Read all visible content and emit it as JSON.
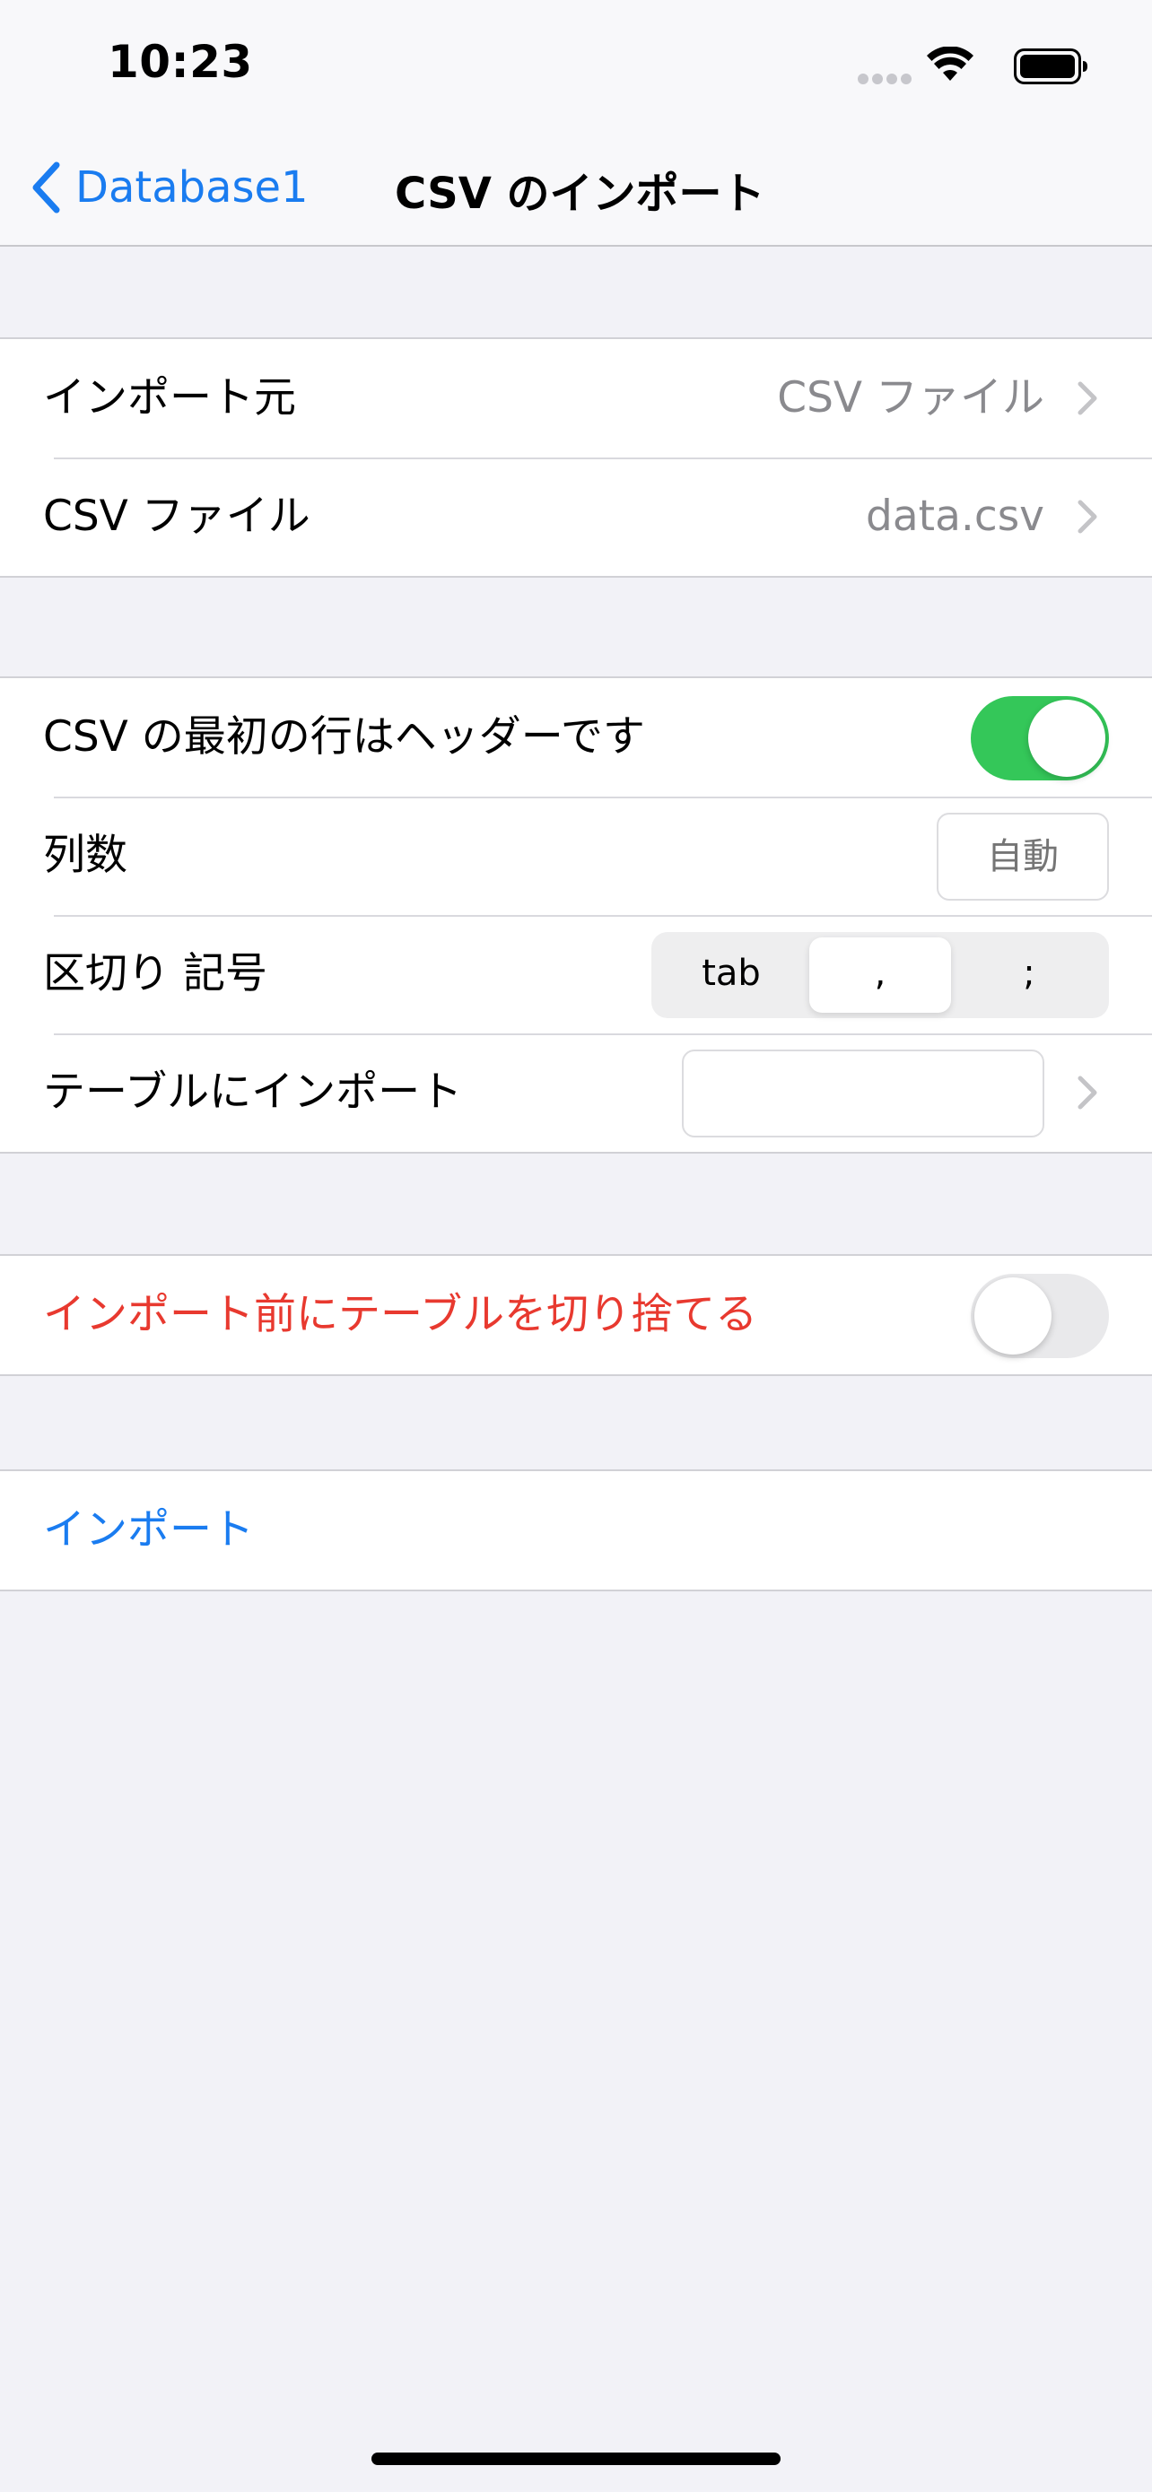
{
  "status_bar": {
    "time": "10:23"
  },
  "nav": {
    "back_label": "Database1",
    "title": "CSV のインポート"
  },
  "source_section": {
    "import_from_label": "インポート元",
    "import_from_value": "CSV ファイル",
    "csv_file_label": "CSV ファイル",
    "csv_file_value": "data.csv"
  },
  "options_section": {
    "header_row_label": "CSV の最初の行はヘッダーです",
    "header_row_enabled": true,
    "column_count_label": "列数",
    "column_count_placeholder": "自動",
    "delimiter_label": "区切り 記号",
    "delimiter_options": [
      "tab",
      ",",
      ";"
    ],
    "delimiter_selected": ",",
    "import_to_table_label": "テーブルにインポート",
    "import_to_table_value": ""
  },
  "truncate_section": {
    "label": "インポート前にテーブルを切り捨てる",
    "enabled": false
  },
  "action_section": {
    "import_label": "インポート"
  },
  "colors": {
    "accent": "#1a7cf0",
    "toggle_on": "#34c759",
    "danger": "#e8392f",
    "background": "#f2f2f7"
  }
}
